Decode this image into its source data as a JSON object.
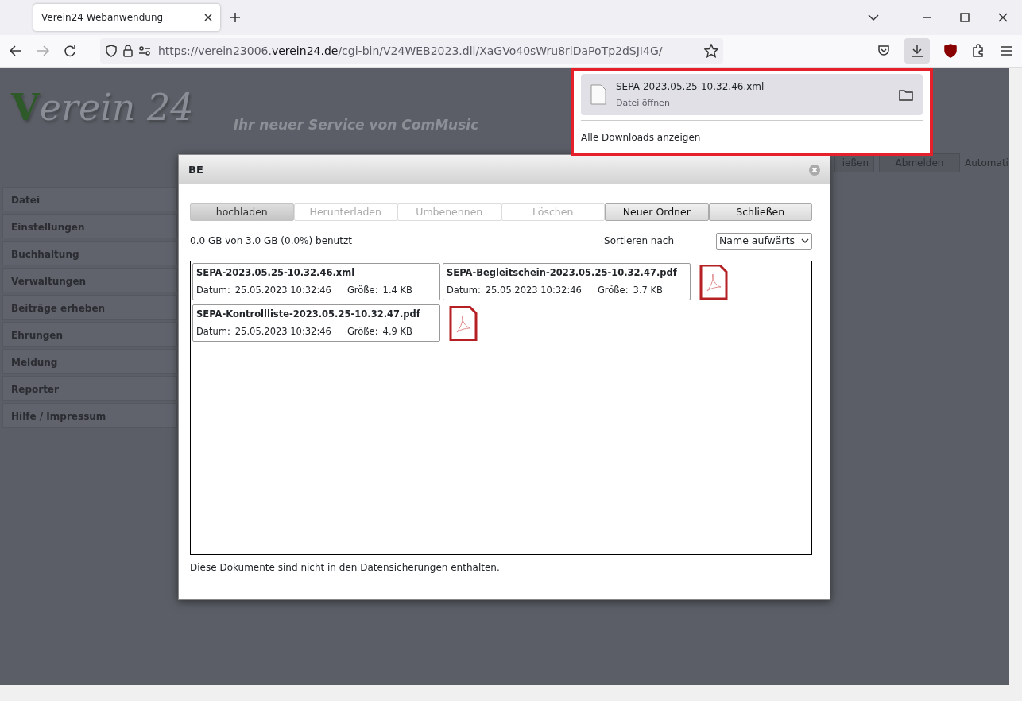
{
  "browser": {
    "tab": {
      "title": "Verein24 Webanwendung",
      "selected": true
    },
    "url": {
      "prefix": "https://verein23006.",
      "domain": "verein24.de",
      "path": "/cgi-bin/V24WEB2023.dll/XaGVo40sWru8rlDaPoTp2dSJI4G/"
    }
  },
  "downloads_panel": {
    "file": "SEPA-2023.05.25-10.32.46.xml",
    "action": "Datei öffnen",
    "show_all": "Alle Downloads anzeigen"
  },
  "page": {
    "logo": "Verein 24",
    "slogan": "Ihr neuer Service von ComMusic",
    "header_buttons": [
      "ießen",
      "Abmelden"
    ],
    "header_text": "Automati",
    "sidebar": {
      "items": [
        "Datei",
        "Einstellungen",
        "Buchhaltung",
        "Verwaltungen",
        "Beiträge erheben",
        "Ehrungen",
        "Meldung",
        "Reporter",
        "Hilfe / Impressum"
      ]
    }
  },
  "dialog": {
    "title": "BE",
    "buttons": [
      {
        "label": "hochladen",
        "disabled": false,
        "selected": true
      },
      {
        "label": "Herunterladen",
        "disabled": true,
        "selected": false
      },
      {
        "label": "Umbenennen",
        "disabled": true,
        "selected": false
      },
      {
        "label": "Löschen",
        "disabled": true,
        "selected": false
      },
      {
        "label": "Neuer Ordner",
        "disabled": false,
        "selected": false
      },
      {
        "label": "Schließen",
        "disabled": false,
        "selected": false
      }
    ],
    "usage": "0.0 GB von 3.0 GB (0.0%) benutzt",
    "sort_label": "Sortieren nach",
    "sort_value": "Name aufwärts",
    "files": [
      {
        "name": "SEPA-2023.05.25-10.32.46.xml",
        "date_label": "Datum:",
        "date": "25.05.2023 10:32:46",
        "size_label": "Größe:",
        "size": "1.4 KB",
        "kind": "xml"
      },
      {
        "name": "SEPA-Begleitschein-2023.05.25-10.32.47.pdf",
        "date_label": "Datum:",
        "date": "25.05.2023 10:32:46",
        "size_label": "Größe:",
        "size": "3.7 KB",
        "kind": "pdf"
      },
      {
        "name": "SEPA-Kontrollliste-2023.05.25-10.32.47.pdf",
        "date_label": "Datum:",
        "date": "25.05.2023 10:32:46",
        "size_label": "Größe:",
        "size": "4.9 KB",
        "kind": "pdf"
      }
    ],
    "footer": "Diese Dokumente sind nicht in den Datensicherungen enthalten."
  }
}
